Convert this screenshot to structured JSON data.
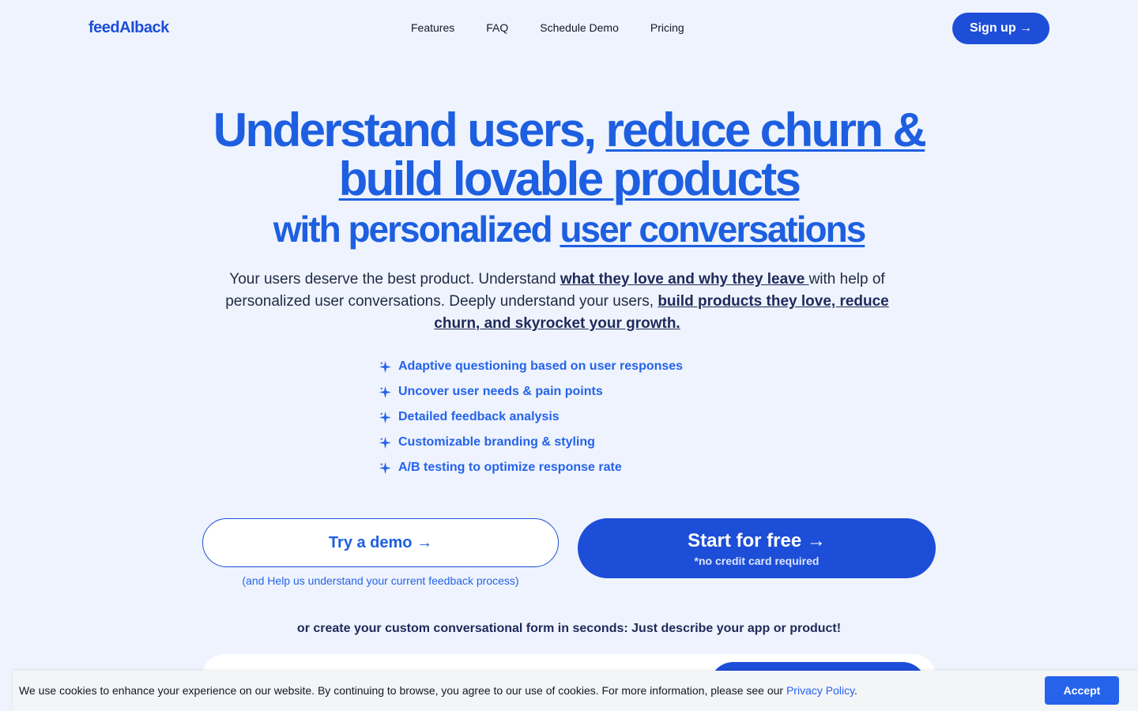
{
  "nav": {
    "logo": "feedAIback",
    "links": [
      "Features",
      "FAQ",
      "Schedule Demo",
      "Pricing"
    ],
    "signup_label": "Sign up →"
  },
  "hero": {
    "line1_plain": "Understand users, ",
    "line1_underlined": "reduce churn &",
    "line2_underlined": "build lovable products",
    "line3_plain": "with personalized ",
    "line3_underlined": "user conversations",
    "sub_part1": "Your users deserve the best product. Understand ",
    "sub_link1": "what they love and why they leave ",
    "sub_part2": "with help of personalized user conversations. Deeply understand your users, ",
    "sub_link2": "build products they love, reduce churn, and skyrocket your growth."
  },
  "features": [
    "Adaptive questioning based on user responses",
    "Uncover user needs & pain points",
    "Detailed feedback analysis",
    "Customizable branding & styling",
    "A/B testing to optimize response rate"
  ],
  "cta": {
    "demo_label": "Try a demo →",
    "demo_note": "(and Help us understand your current feedback process)",
    "start_label": "Start for free →",
    "start_note": "*no credit card required"
  },
  "create_line": "or create your custom conversational form in seconds: Just describe your app or product!",
  "cookie": {
    "text": "We use cookies to enhance your experience on our website. By continuing to browse, you agree to our use of cookies. For more information, please see our ",
    "link": "Privacy Policy",
    "after": ".",
    "accept_label": "Accept"
  },
  "icons": {
    "feature_bullet": "sparkle-icon"
  },
  "colors": {
    "accent": "#1d4ed8",
    "heading": "#1d5fe0",
    "background": "#eef3fd"
  }
}
